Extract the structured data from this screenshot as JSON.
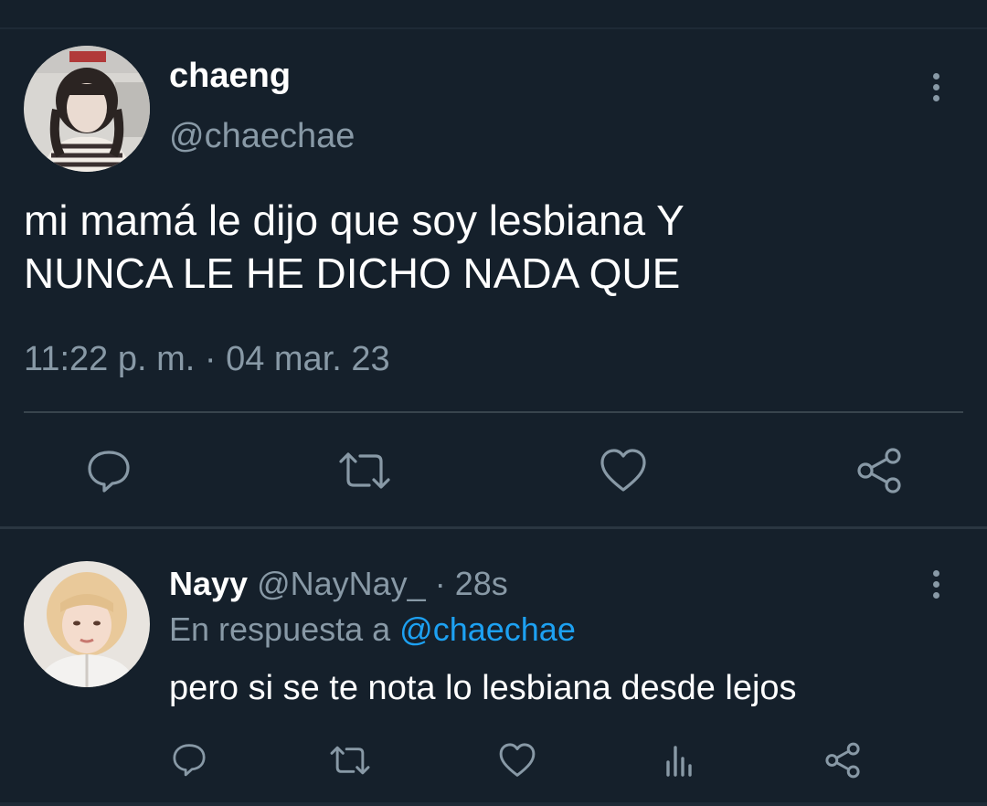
{
  "tweet": {
    "author_name": "chaeng",
    "author_handle": "@chaechae",
    "text_lines": [
      "mi mamá le dijo que soy lesbiana Y",
      "NUNCA LE HE DICHO NADA QUE"
    ],
    "time": "11:22 p. m.",
    "separator": " · ",
    "date": "04 mar. 23"
  },
  "reply": {
    "author_name": "Nayy",
    "author_handle": "@NayNay_",
    "age": "28s",
    "meta_separator": " · ",
    "reply_prefix": "En respuesta a ",
    "reply_mention": "@chaechae",
    "text": "pero si se te nota lo lesbiana desde lejos"
  },
  "icons": {
    "main_actions": [
      "reply-icon",
      "retweet-icon",
      "like-icon",
      "share-icon"
    ],
    "reply_actions": [
      "reply-icon",
      "retweet-icon",
      "like-icon",
      "analytics-icon",
      "share-icon"
    ]
  },
  "colors": {
    "background": "#15202b",
    "secondary_text": "#8899a6",
    "accent": "#1da1f2",
    "divider": "#38444d"
  }
}
